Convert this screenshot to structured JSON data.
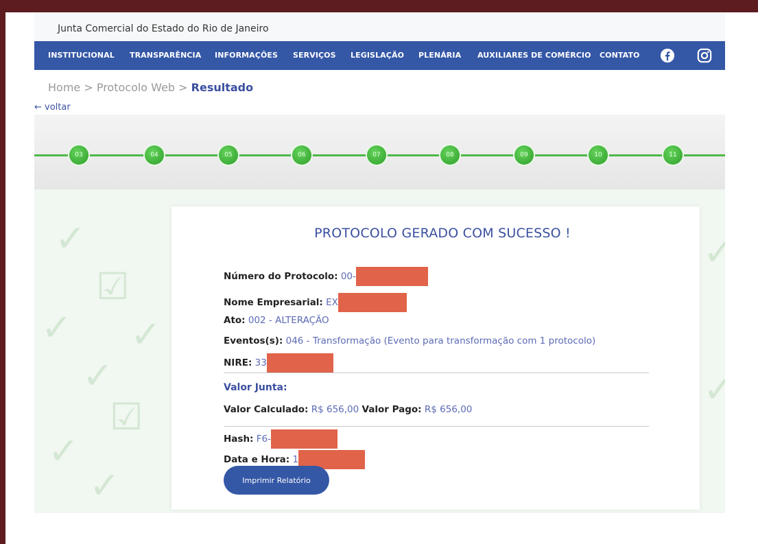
{
  "site": {
    "title": "Junta Comercial do Estado do Rio de Janeiro"
  },
  "nav": {
    "items": [
      {
        "label": "INSTITUCIONAL"
      },
      {
        "label": "TRANSPARÊNCIA"
      },
      {
        "label": "INFORMAÇÕES"
      },
      {
        "label": "SERVIÇOS"
      },
      {
        "label": "LEGISLAÇÃO"
      },
      {
        "label": "PLENÁRIA"
      },
      {
        "label": "AUXILIARES DE COMÉRCIO"
      },
      {
        "label": "CONTATO"
      }
    ],
    "social_icons": [
      "facebook-icon",
      "instagram-icon"
    ]
  },
  "breadcrumb": {
    "home": "Home",
    "sep1": " > ",
    "protocolo": "Protocolo Web",
    "sep2": " > ",
    "current": "Resultado"
  },
  "back": {
    "label": "← voltar"
  },
  "steps": [
    "03",
    "04",
    "05",
    "06",
    "07",
    "08",
    "09",
    "10",
    "11"
  ],
  "colors": {
    "nav": "#3457a6",
    "step": "#3fb13a",
    "accent_text": "#3a4fa0",
    "redaction": "#e0634a",
    "frame": "#5d1d20"
  },
  "result": {
    "title": "PROTOCOLO GERADO COM SUCESSO !",
    "protocolo_label": "Número do Protocolo:",
    "protocolo_value": "00-",
    "nome_label": "Nome Empresarial:",
    "nome_value": "EX",
    "ato_label": "Ato:",
    "ato_value": "002 - ALTERAÇÃO",
    "eventos_label": "Eventos(s):",
    "eventos_value": "046 - Transformação (Evento para transformação com 1 protocolo)",
    "nire_label": "NIRE:",
    "nire_value": "33",
    "valor_heading": "Valor Junta:",
    "valor_calc_label": "Valor Calculado:",
    "valor_calc_value": "R$ 656,00",
    "valor_pago_label": "Valor Pago:",
    "valor_pago_value": "R$ 656,00",
    "hash_label": "Hash:",
    "hash_value": "F6-",
    "data_label": "Data e Hora:",
    "data_value": "1",
    "print_label": "Imprimir Relatório"
  }
}
